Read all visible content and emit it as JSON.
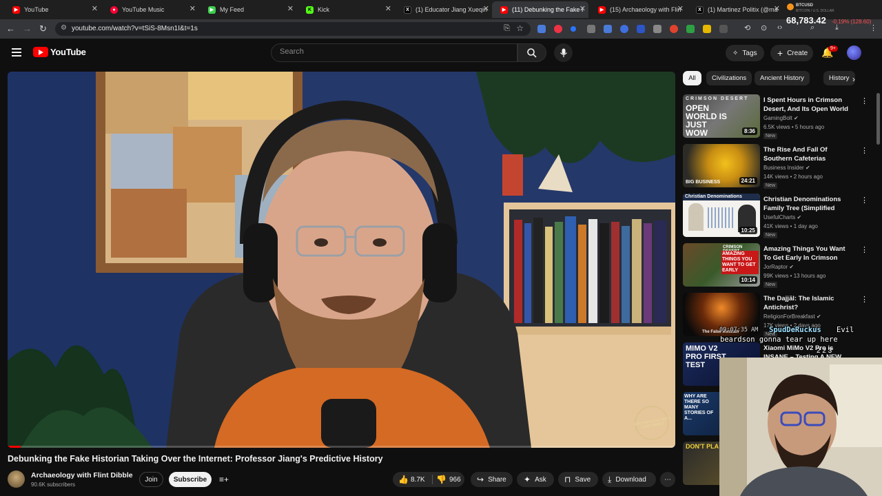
{
  "browser": {
    "tabs": [
      {
        "label": "YouTube",
        "favicon_color": "#ff0000",
        "active": false
      },
      {
        "label": "YouTube Music",
        "favicon_color": "#ff0033",
        "active": false
      },
      {
        "label": "My Feed",
        "favicon_color": "#3ccf4e",
        "active": false
      },
      {
        "label": "Kick",
        "favicon_color": "#53fc18",
        "active": false
      },
      {
        "label": "(1) Educator Jiang Xueqin",
        "favicon_color": "#000000",
        "active": false
      },
      {
        "label": "(11) Debunking the Fake I",
        "favicon_color": "#ff0000",
        "active": true
      },
      {
        "label": "(15) Archaeology with Flin",
        "favicon_color": "#ff0000",
        "active": false
      },
      {
        "label": "(1) Martinez Politix (@ma",
        "favicon_color": "#000000",
        "active": false
      }
    ],
    "url": "youtube.com/watch?v=tSiS-8Msn1I&t=1s",
    "ticker": {
      "symbol": "BTCUSD",
      "pair": "BITCOIN / U.S. DOLLAR",
      "price": "68,783.42",
      "change": "-0.19% (128.60)"
    }
  },
  "header": {
    "logo_text": "YouTube",
    "search_placeholder": "Search",
    "tags_label": "Tags",
    "create_label": "Create",
    "notification_badge": "9+"
  },
  "player": {
    "watermark_text": "ARCHAEOLOGY WITH FLINT DIBBLE",
    "progress": 0.003
  },
  "video": {
    "title": "Debunking the Fake Historian Taking Over the Internet: Professor Jiang's Predictive History",
    "channel_name": "Archaeology with Flint Dibble",
    "subscribers": "90.6K subscribers",
    "join_label": "Join",
    "subscribe_label": "Subscribe",
    "like_count": "8.7K",
    "dislike_count": "966",
    "share_label": "Share",
    "ask_label": "Ask",
    "save_label": "Save",
    "download_label": "Download"
  },
  "chips": [
    "All",
    "Civilizations",
    "Ancient History",
    "History"
  ],
  "recommendations": [
    {
      "title": "I Spent Hours in Crimson Desert, And Its Open World ...",
      "channel": "GamingBolt",
      "meta": "6.5K views • 5 hours ago",
      "badge": "New",
      "duration": "8:36",
      "thumb_text": "OPEN WORLD IS JUST WOW",
      "thumb_top": "CRIMSON DESERT"
    },
    {
      "title": "The Rise And Fall Of Southern Cafeterias",
      "channel": "Business Insider",
      "meta": "14K views • 2 hours ago",
      "badge": "New",
      "duration": "24:21",
      "thumb_text": "BIG BUSINESS"
    },
    {
      "title": "Christian Denominations Family Tree (Simplified Version)",
      "channel": "UsefulCharts",
      "meta": "41K views • 1 day ago",
      "badge": "New",
      "duration": "10:25",
      "thumb_text": "Christian Denominations"
    },
    {
      "title": "Amazing Things You Want To Get Early In Crimson Desert... -",
      "channel": "JorRaptor",
      "meta": "99K views • 13 hours ago",
      "badge": "New",
      "duration": "10:14",
      "thumb_text": "AMAZING THINGS YOU WANT TO GET EARLY",
      "thumb_top": "CRIMSON DESERT"
    },
    {
      "title": "The Dajjāl: The Islamic Antichrist?",
      "channel": "ReligionForBreakfast",
      "meta": "17K views • 2 days ago",
      "badge": "New",
      "duration": "",
      "thumb_text": "The False Messiah"
    },
    {
      "title": "Xiaomi MiMo V2 Pro is INSANE – Testing A NEW Frontier...",
      "channel": "",
      "meta": "",
      "badge": "",
      "duration": "",
      "thumb_text": "MIMO V2 PRO FIRST TEST"
    },
    {
      "title": "",
      "channel": "",
      "meta": "",
      "badge": "",
      "duration": "",
      "thumb_text": "WHY ARE THERE SO MANY STORIES OF A..."
    },
    {
      "title": "",
      "channel": "",
      "meta": "",
      "badge": "",
      "duration": "",
      "thumb_text": "DON'T PLA"
    }
  ],
  "chat_overlay": {
    "time": "09:07:35 AM",
    "username": "SpudDeRuckus",
    "message_line1": "Evil",
    "message_line2": "beardson gonna tear up here",
    "counts": "2  2  3"
  },
  "colors": {
    "accent": "#ff0000",
    "background": "#0f0f0f",
    "chip_bg": "#272727",
    "text_secondary": "#aaaaaa"
  }
}
